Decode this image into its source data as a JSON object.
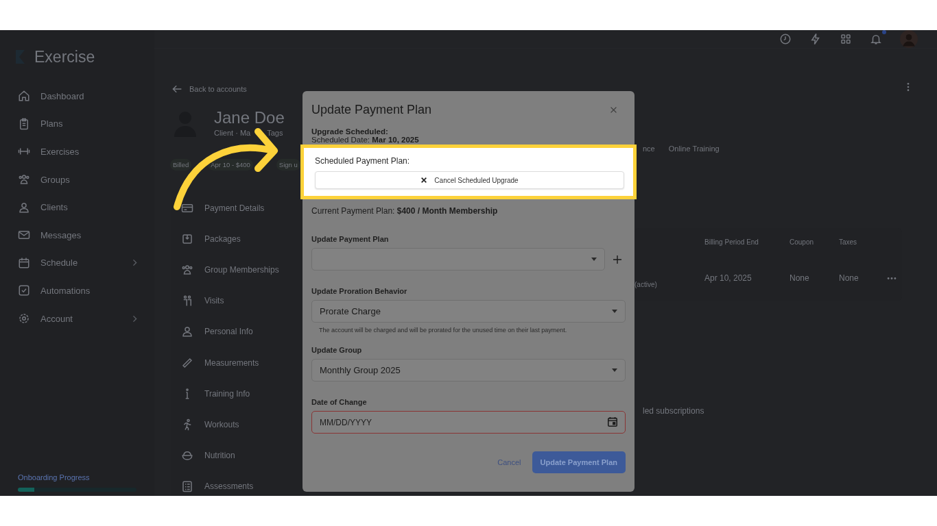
{
  "sidebar": {
    "logo": "Exercise",
    "items": [
      {
        "label": "Dashboard",
        "has_submenu": false
      },
      {
        "label": "Plans",
        "has_submenu": false
      },
      {
        "label": "Exercises",
        "has_submenu": false
      },
      {
        "label": "Groups",
        "has_submenu": false
      },
      {
        "label": "Clients",
        "has_submenu": false
      },
      {
        "label": "Messages",
        "has_submenu": false
      },
      {
        "label": "Schedule",
        "has_submenu": true
      },
      {
        "label": "Automations",
        "has_submenu": false
      },
      {
        "label": "Account",
        "has_submenu": true
      }
    ],
    "onboarding": {
      "label": "Onboarding Progress",
      "level": 0.14
    }
  },
  "header": {
    "notification_dot": true
  },
  "profile": {
    "back_link": "Back to accounts",
    "name": "Jane Doe",
    "meta": [
      "Client · Ma",
      "Tags"
    ],
    "chips": [
      "Billed",
      "Apr 10 - $400",
      "Sign u"
    ]
  },
  "client_menu": [
    "Payment Details",
    "Packages",
    "Group Memberships",
    "Visits",
    "Personal Info",
    "Measurements",
    "Training Info",
    "Workouts",
    "Nutrition",
    "Assessments"
  ],
  "tabs": [
    "nce",
    "Online Training"
  ],
  "table": {
    "columns": [
      "",
      "Billing Period End",
      "Coupon",
      "Taxes",
      ""
    ],
    "rows": [
      [
        "(active)",
        "Apr 10, 2025",
        "None",
        "None"
      ]
    ]
  },
  "subscriptions_note": "led subscriptions",
  "modal": {
    "title": "Update Payment Plan",
    "upgrade_label": "Upgrade Scheduled:",
    "scheduled_date": "Scheduled Date: **Mar 10, 2025**",
    "scheduled_plan_label": "Scheduled Payment Plan:",
    "cancel_upgrade_button": "Cancel Scheduled Upgrade",
    "current_plan": "Current Payment Plan: **$400 / Month Membership**",
    "fields": [
      {
        "kind": "select",
        "label": "Update Payment Plan",
        "add_button": true,
        "invalid": false
      },
      {
        "kind": "select",
        "label": "Update Proration Behavior",
        "value": "Prorate Charge",
        "helper": "The account will be charged and will be prorated for the unused time on their last payment.",
        "add_button": false,
        "invalid": false
      },
      {
        "kind": "select",
        "label": "Update Group",
        "value": "Monthly Group 2025",
        "add_button": false,
        "invalid": false
      },
      {
        "kind": "date",
        "label": "Date of Change",
        "placeholder": "MM/DD/YYYY",
        "add_button": false,
        "invalid": true
      }
    ],
    "cancel_button": "Cancel",
    "submit_button": "Update Payment Plan"
  }
}
